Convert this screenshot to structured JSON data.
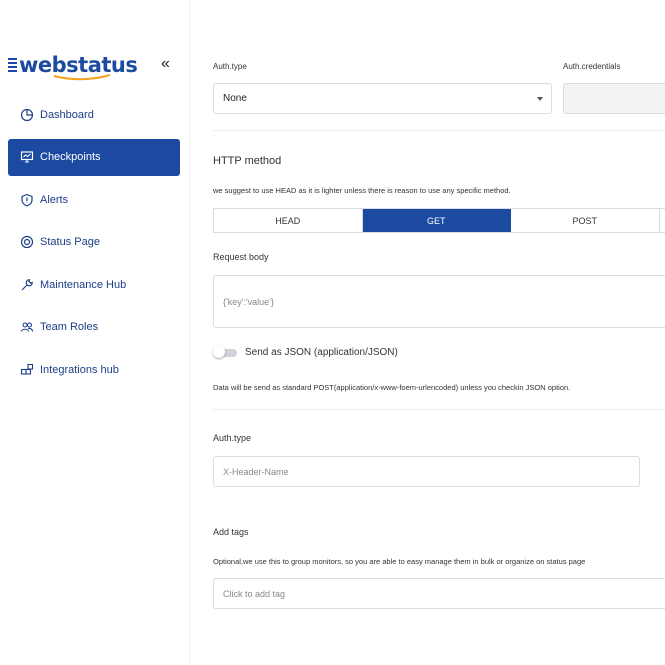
{
  "brand": {
    "logo_text": "webstatus",
    "primary": "#1b4aa0"
  },
  "sidebar": {
    "collapse_label": "«",
    "items": [
      {
        "label": "Dashboard",
        "icon": "dashboard-icon",
        "active": false
      },
      {
        "label": "Checkpoints",
        "icon": "monitor-icon",
        "active": true
      },
      {
        "label": "Alerts",
        "icon": "shield-icon",
        "active": false
      },
      {
        "label": "Status Page",
        "icon": "status-icon",
        "active": false
      },
      {
        "label": "Maintenance Hub",
        "icon": "wrench-icon",
        "active": false
      },
      {
        "label": "Team Roles",
        "icon": "team-icon",
        "active": false
      },
      {
        "label": "Integrations hub",
        "icon": "integrations-icon",
        "active": false
      }
    ]
  },
  "auth": {
    "type_label": "Auth.type",
    "type_value": "None",
    "credentials_label": "Auth.credentials"
  },
  "http": {
    "title": "HTTP method",
    "hint": "we suggest to use HEAD as it is lighter unless there is reason to use any specific method.",
    "methods": [
      "HEAD",
      "GET",
      "POST"
    ],
    "selected": "GET"
  },
  "request_body": {
    "label": "Request body",
    "placeholder": "{'key':'value'}"
  },
  "json_toggle": {
    "label": "Send as JSON (application/JSON)",
    "enabled": false,
    "note": "Data will be send as standard POST(application/x-www-foem-urlencoded) unless you checkin JSON option."
  },
  "auth_header": {
    "label": "Auth.type",
    "placeholder": "X-Header-Name"
  },
  "tags": {
    "label": "Add tags",
    "hint": "Optional,we use this to group monitors, so you are able to easy manage them in bulk or organize on status page",
    "placeholder": "Click to add tag"
  }
}
